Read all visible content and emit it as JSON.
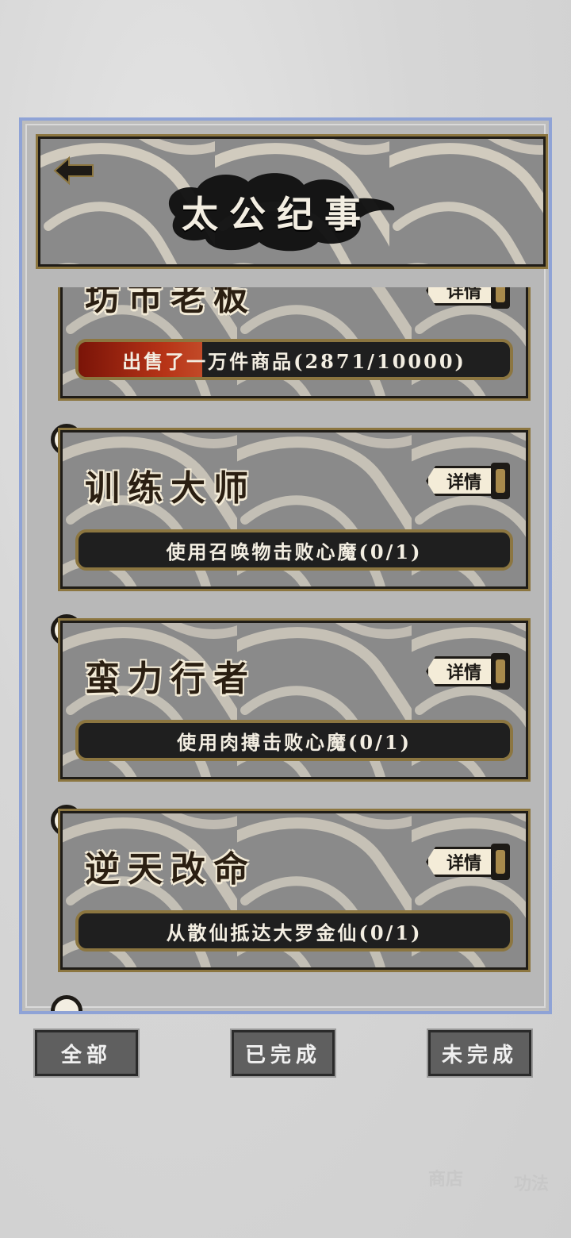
{
  "header": {
    "title": "太公纪事",
    "back_icon": "back-arrow-icon"
  },
  "achievements": [
    {
      "title": "坊市老板",
      "detail_label": "详情",
      "progress_text": "出售了一万件商品(2871/10000)",
      "progress": 0.2871
    },
    {
      "title": "训练大师",
      "detail_label": "详情",
      "progress_text": "使用召唤物击败心魔(0/1)",
      "progress": 0
    },
    {
      "title": "蛮力行者",
      "detail_label": "详情",
      "progress_text": "使用肉搏击败心魔(0/1)",
      "progress": 0
    },
    {
      "title": "逆天改命",
      "detail_label": "详情",
      "progress_text": "从散仙抵达大罗金仙(0/1)",
      "progress": 0
    }
  ],
  "tabs": {
    "all": "全部",
    "completed": "已完成",
    "incomplete": "未完成"
  },
  "background_nav": {
    "shop": "商店",
    "skills": "功法"
  },
  "colors": {
    "frame_gold": "#8c7640",
    "progress_red": "#b73417",
    "panel_border": "#8fa3d6"
  }
}
